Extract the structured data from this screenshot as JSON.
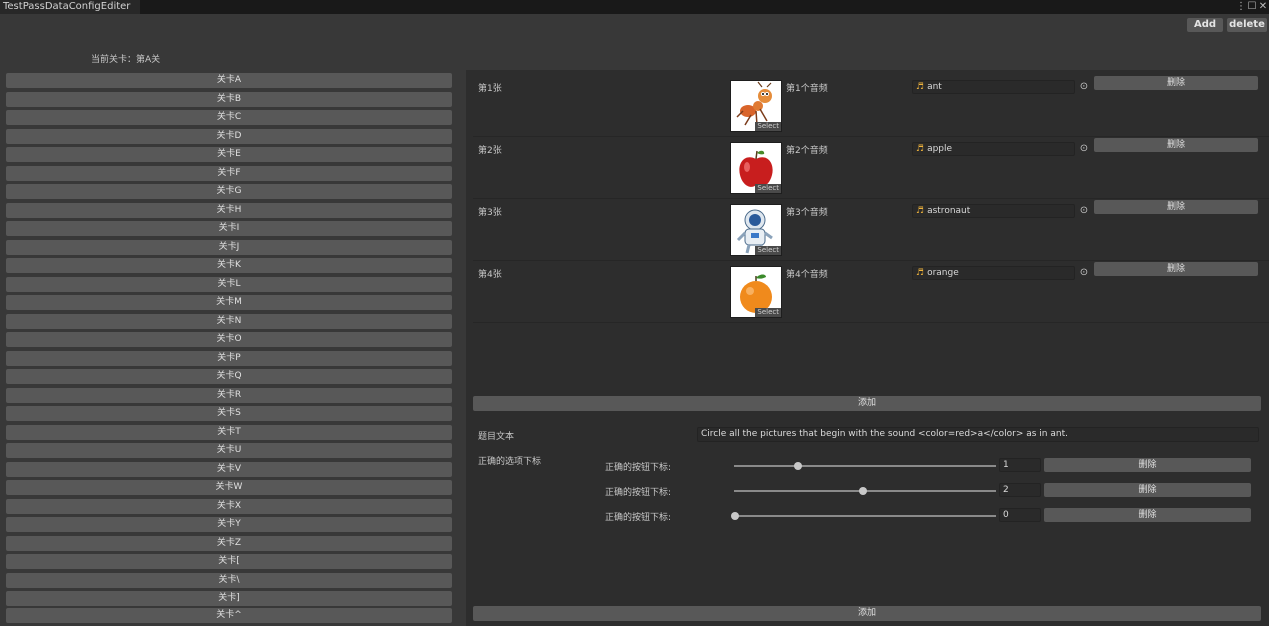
{
  "window": {
    "tab_title": "TestPassDataConfigEditer",
    "menu_icon": "kebab-menu-icon",
    "maximize_icon": "maximize-icon",
    "close_icon": "close-icon"
  },
  "toolbar": {
    "add_label": "Add",
    "delete_label": "delete"
  },
  "current_level": "当前关卡：第A关",
  "levels": [
    "关卡A",
    "关卡B",
    "关卡C",
    "关卡D",
    "关卡E",
    "关卡F",
    "关卡G",
    "关卡H",
    "关卡I",
    "关卡J",
    "关卡K",
    "关卡L",
    "关卡M",
    "关卡N",
    "关卡O",
    "关卡P",
    "关卡Q",
    "关卡R",
    "关卡S",
    "关卡T",
    "关卡U",
    "关卡V",
    "关卡W",
    "关卡X",
    "关卡Y",
    "关卡Z",
    "关卡[",
    "关卡\\",
    "关卡]",
    "关卡^"
  ],
  "entries": [
    {
      "label": "第1张",
      "image": "ant-picture",
      "select": "Select",
      "audio_label": "第1个音频",
      "audio": "ant",
      "delete": "删除"
    },
    {
      "label": "第2张",
      "image": "apple-picture",
      "select": "Select",
      "audio_label": "第2个音频",
      "audio": "apple",
      "delete": "删除"
    },
    {
      "label": "第3张",
      "image": "astronaut-picture",
      "select": "Select",
      "audio_label": "第3个音频",
      "audio": "astronaut",
      "delete": "删除"
    },
    {
      "label": "第4张",
      "image": "orange-picture",
      "select": "Select",
      "audio_label": "第4个音频",
      "audio": "orange",
      "delete": "删除"
    }
  ],
  "add_label_1": "添加",
  "question": {
    "label": "题目文本",
    "value": "Circle all the pictures that begin with the sound <color=red>a</color> as in ant."
  },
  "correct": {
    "label": "正确的选项下标",
    "items": [
      {
        "label": "正确的按钮下标:",
        "value": "1",
        "delete": "删除"
      },
      {
        "label": "正确的按钮下标:",
        "value": "2",
        "delete": "删除"
      },
      {
        "label": "正确的按钮下标:",
        "value": "0",
        "delete": "删除"
      }
    ],
    "slider_max": 3
  },
  "add_label_2": "添加",
  "colors": {
    "accent_note": "#f0b43c",
    "button": "#585858",
    "panel": "#2d2d2d"
  }
}
